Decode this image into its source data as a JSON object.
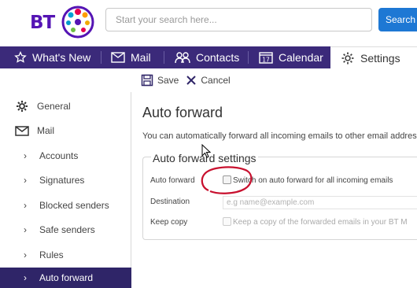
{
  "brand": {
    "logo_text": "BT",
    "accent": "#5514b4",
    "nav_bg": "#3b2a7a"
  },
  "search": {
    "placeholder": "Start your search here...",
    "button_label": "Search"
  },
  "nav": {
    "tabs": [
      {
        "label": "What's New",
        "icon": "star-icon"
      },
      {
        "label": "Mail",
        "icon": "envelope-icon"
      },
      {
        "label": "Contacts",
        "icon": "people-icon"
      },
      {
        "label": "Calendar",
        "icon": "calendar-icon",
        "icon_text": "17"
      },
      {
        "label": "Settings",
        "icon": "gear-icon",
        "active": true
      }
    ]
  },
  "toolbar": {
    "save_label": "Save",
    "cancel_label": "Cancel"
  },
  "sidebar": {
    "items": [
      {
        "label": "General",
        "icon": "gear-icon"
      },
      {
        "label": "Mail",
        "icon": "envelope-icon"
      },
      {
        "label": "Accounts"
      },
      {
        "label": "Signatures"
      },
      {
        "label": "Blocked senders"
      },
      {
        "label": "Safe senders"
      },
      {
        "label": "Rules"
      },
      {
        "label": "Auto forward",
        "active": true
      }
    ]
  },
  "main": {
    "title": "Auto forward",
    "intro": "You can automatically forward all incoming emails to other email addres",
    "legend": "Auto forward settings",
    "rows": {
      "auto_forward": {
        "label": "Auto forward",
        "text": "Switch on auto forward for all incoming emails",
        "checked": false
      },
      "destination": {
        "label": "Destination",
        "placeholder": "e.g name@example.com"
      },
      "keep_copy": {
        "label": "Keep copy",
        "text": "Keep a copy of the forwarded emails in your BT M",
        "checked": false
      }
    }
  }
}
